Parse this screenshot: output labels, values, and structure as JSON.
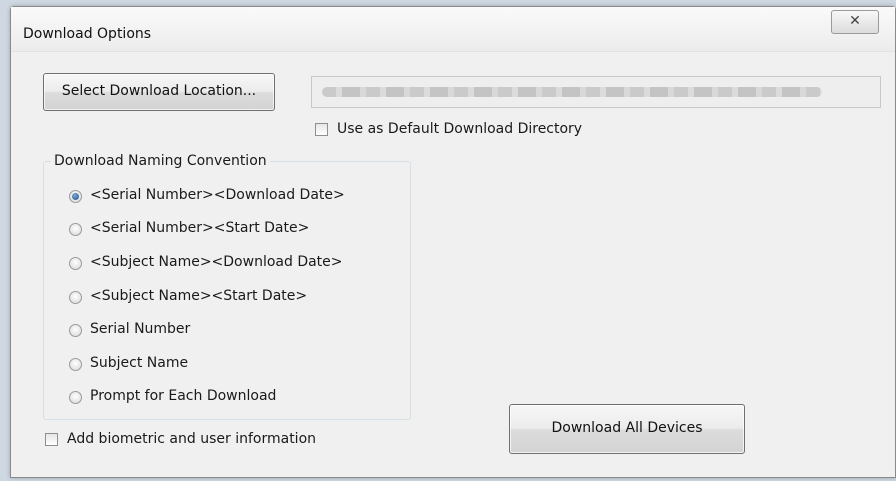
{
  "window": {
    "title": "Download Options",
    "close_glyph": "✕"
  },
  "location": {
    "select_button_label": "Select Download Location...",
    "path_value": "",
    "default_dir_label": "Use as Default Download Directory",
    "default_dir_checked": false
  },
  "naming": {
    "legend": "Download Naming Convention",
    "options": [
      {
        "label": "<Serial Number><Download Date>",
        "checked": true
      },
      {
        "label": "<Serial Number><Start Date>",
        "checked": false
      },
      {
        "label": "<Subject Name><Download Date>",
        "checked": false
      },
      {
        "label": "<Subject Name><Start Date>",
        "checked": false
      },
      {
        "label": "Serial Number",
        "checked": false
      },
      {
        "label": "Subject Name",
        "checked": false
      },
      {
        "label": "Prompt for Each Download",
        "checked": false
      }
    ]
  },
  "biometric": {
    "label": "Add biometric and user information",
    "checked": false
  },
  "download_all_label": "Download All Devices"
}
